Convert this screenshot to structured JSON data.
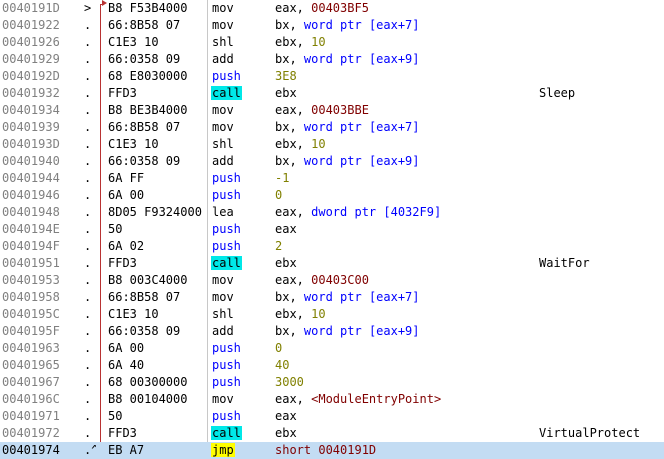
{
  "colors": {
    "selected_row_bg": "#c3dcf3",
    "call_highlight": "#00e8e8",
    "jmp_highlight": "#ffff00",
    "push_color": "#0000ff",
    "number_color": "#808000",
    "address_color": "#800000",
    "jump_line": "#b83232"
  },
  "rows": [
    {
      "addr": "0040191D",
      "gutter": ">",
      "bytes": "B8 F53B4000",
      "mnemonic": "mov",
      "ops": [
        {
          "t": "reg",
          "v": "eax, "
        },
        {
          "t": "addr",
          "v": "00403BF5"
        }
      ],
      "comment": ""
    },
    {
      "addr": "00401922",
      "gutter": ".",
      "bytes": "66:8B58 07",
      "mnemonic": "mov",
      "ops": [
        {
          "t": "reg",
          "v": "bx, "
        },
        {
          "t": "kw",
          "v": "word ptr "
        },
        {
          "t": "kw",
          "v": "[eax+7]"
        }
      ],
      "comment": ""
    },
    {
      "addr": "00401926",
      "gutter": ".",
      "bytes": "C1E3 10",
      "mnemonic": "shl",
      "ops": [
        {
          "t": "reg",
          "v": "ebx, "
        },
        {
          "t": "num",
          "v": "10"
        }
      ],
      "comment": ""
    },
    {
      "addr": "00401929",
      "gutter": ".",
      "bytes": "66:0358 09",
      "mnemonic": "add",
      "ops": [
        {
          "t": "reg",
          "v": "bx, "
        },
        {
          "t": "kw",
          "v": "word ptr "
        },
        {
          "t": "kw",
          "v": "[eax+9]"
        }
      ],
      "comment": ""
    },
    {
      "addr": "0040192D",
      "gutter": ".",
      "bytes": "68 E8030000",
      "mnemonic": "push",
      "ops": [
        {
          "t": "num",
          "v": "3E8"
        }
      ],
      "comment": ""
    },
    {
      "addr": "00401932",
      "gutter": ".",
      "bytes": "FFD3",
      "mnemonic": "call",
      "ops": [
        {
          "t": "reg",
          "v": "ebx"
        }
      ],
      "comment": "Sleep"
    },
    {
      "addr": "00401934",
      "gutter": ".",
      "bytes": "B8 BE3B4000",
      "mnemonic": "mov",
      "ops": [
        {
          "t": "reg",
          "v": "eax, "
        },
        {
          "t": "addr",
          "v": "00403BBE"
        }
      ],
      "comment": ""
    },
    {
      "addr": "00401939",
      "gutter": ".",
      "bytes": "66:8B58 07",
      "mnemonic": "mov",
      "ops": [
        {
          "t": "reg",
          "v": "bx, "
        },
        {
          "t": "kw",
          "v": "word ptr "
        },
        {
          "t": "kw",
          "v": "[eax+7]"
        }
      ],
      "comment": ""
    },
    {
      "addr": "0040193D",
      "gutter": ".",
      "bytes": "C1E3 10",
      "mnemonic": "shl",
      "ops": [
        {
          "t": "reg",
          "v": "ebx, "
        },
        {
          "t": "num",
          "v": "10"
        }
      ],
      "comment": ""
    },
    {
      "addr": "00401940",
      "gutter": ".",
      "bytes": "66:0358 09",
      "mnemonic": "add",
      "ops": [
        {
          "t": "reg",
          "v": "bx, "
        },
        {
          "t": "kw",
          "v": "word ptr "
        },
        {
          "t": "kw",
          "v": "[eax+9]"
        }
      ],
      "comment": ""
    },
    {
      "addr": "00401944",
      "gutter": ".",
      "bytes": "6A FF",
      "mnemonic": "push",
      "ops": [
        {
          "t": "num",
          "v": "-1"
        }
      ],
      "comment": ""
    },
    {
      "addr": "00401946",
      "gutter": ".",
      "bytes": "6A 00",
      "mnemonic": "push",
      "ops": [
        {
          "t": "num",
          "v": "0"
        }
      ],
      "comment": ""
    },
    {
      "addr": "00401948",
      "gutter": ".",
      "bytes": "8D05 F9324000",
      "mnemonic": "lea",
      "ops": [
        {
          "t": "reg",
          "v": "eax, "
        },
        {
          "t": "kw",
          "v": "dword ptr "
        },
        {
          "t": "kw",
          "v": "[4032F9]"
        }
      ],
      "comment": ""
    },
    {
      "addr": "0040194E",
      "gutter": ".",
      "bytes": "50",
      "mnemonic": "push",
      "ops": [
        {
          "t": "reg",
          "v": "eax"
        }
      ],
      "comment": ""
    },
    {
      "addr": "0040194F",
      "gutter": ".",
      "bytes": "6A 02",
      "mnemonic": "push",
      "ops": [
        {
          "t": "num",
          "v": "2"
        }
      ],
      "comment": ""
    },
    {
      "addr": "00401951",
      "gutter": ".",
      "bytes": "FFD3",
      "mnemonic": "call",
      "ops": [
        {
          "t": "reg",
          "v": "ebx"
        }
      ],
      "comment": "WaitFor"
    },
    {
      "addr": "00401953",
      "gutter": ".",
      "bytes": "B8 003C4000",
      "mnemonic": "mov",
      "ops": [
        {
          "t": "reg",
          "v": "eax, "
        },
        {
          "t": "addr",
          "v": "00403C00"
        }
      ],
      "comment": ""
    },
    {
      "addr": "00401958",
      "gutter": ".",
      "bytes": "66:8B58 07",
      "mnemonic": "mov",
      "ops": [
        {
          "t": "reg",
          "v": "bx, "
        },
        {
          "t": "kw",
          "v": "word ptr "
        },
        {
          "t": "kw",
          "v": "[eax+7]"
        }
      ],
      "comment": ""
    },
    {
      "addr": "0040195C",
      "gutter": ".",
      "bytes": "C1E3 10",
      "mnemonic": "shl",
      "ops": [
        {
          "t": "reg",
          "v": "ebx, "
        },
        {
          "t": "num",
          "v": "10"
        }
      ],
      "comment": ""
    },
    {
      "addr": "0040195F",
      "gutter": ".",
      "bytes": "66:0358 09",
      "mnemonic": "add",
      "ops": [
        {
          "t": "reg",
          "v": "bx, "
        },
        {
          "t": "kw",
          "v": "word ptr "
        },
        {
          "t": "kw",
          "v": "[eax+9]"
        }
      ],
      "comment": ""
    },
    {
      "addr": "00401963",
      "gutter": ".",
      "bytes": "6A 00",
      "mnemonic": "push",
      "ops": [
        {
          "t": "num",
          "v": "0"
        }
      ],
      "comment": ""
    },
    {
      "addr": "00401965",
      "gutter": ".",
      "bytes": "6A 40",
      "mnemonic": "push",
      "ops": [
        {
          "t": "num",
          "v": "40"
        }
      ],
      "comment": ""
    },
    {
      "addr": "00401967",
      "gutter": ".",
      "bytes": "68 00300000",
      "mnemonic": "push",
      "ops": [
        {
          "t": "num",
          "v": "3000"
        }
      ],
      "comment": ""
    },
    {
      "addr": "0040196C",
      "gutter": ".",
      "bytes": "B8 00104000",
      "mnemonic": "mov",
      "ops": [
        {
          "t": "reg",
          "v": "eax, "
        },
        {
          "t": "sym",
          "v": "<ModuleEntryPoint>"
        }
      ],
      "comment": ""
    },
    {
      "addr": "00401971",
      "gutter": ".",
      "bytes": "50",
      "mnemonic": "push",
      "ops": [
        {
          "t": "reg",
          "v": "eax"
        }
      ],
      "comment": ""
    },
    {
      "addr": "00401972",
      "gutter": ".",
      "bytes": "FFD3",
      "mnemonic": "call",
      "ops": [
        {
          "t": "reg",
          "v": "ebx"
        }
      ],
      "comment": "VirtualProtect"
    },
    {
      "addr": "00401974",
      "gutter": ".^",
      "bytes": "EB A7",
      "mnemonic": "jmp",
      "ops": [
        {
          "t": "addr",
          "v": "short 0040191D"
        }
      ],
      "comment": "",
      "selected": true
    }
  ]
}
